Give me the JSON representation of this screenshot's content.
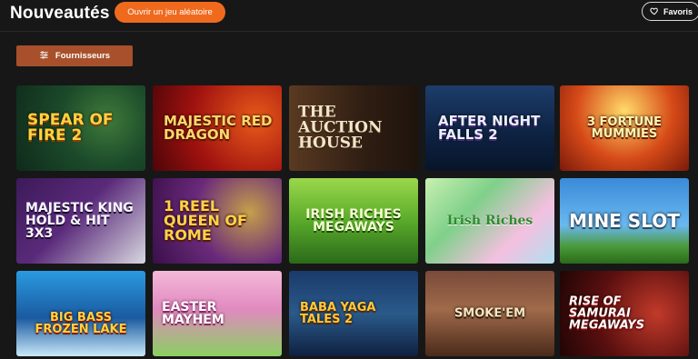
{
  "header": {
    "title": "Nouveautés",
    "random_button": "Ouvrir un jeu aléatoire",
    "favorites_button": "Favoris"
  },
  "filters": {
    "providers_button": "Fournisseurs"
  },
  "games": [
    {
      "title": "Spear of Fire 2"
    },
    {
      "title": "Majestic Red Dragon"
    },
    {
      "title": "The Auction House"
    },
    {
      "title": "After Night Falls 2"
    },
    {
      "title": "3 Fortune Mummies"
    },
    {
      "title": "Majestic King Hold & Hit 3x3"
    },
    {
      "title": "1 Reel Queen of Rome"
    },
    {
      "title": "Irish Riches Megaways"
    },
    {
      "title": "Irish Riches"
    },
    {
      "title": "Mine Slot"
    },
    {
      "title": "Big Bass Frozen Lake"
    },
    {
      "title": "Easter Mayhem"
    },
    {
      "title": "Baba Yaga Tales 2"
    },
    {
      "title": "Smoke'em"
    },
    {
      "title": "Rise of Samurai Megaways"
    }
  ]
}
